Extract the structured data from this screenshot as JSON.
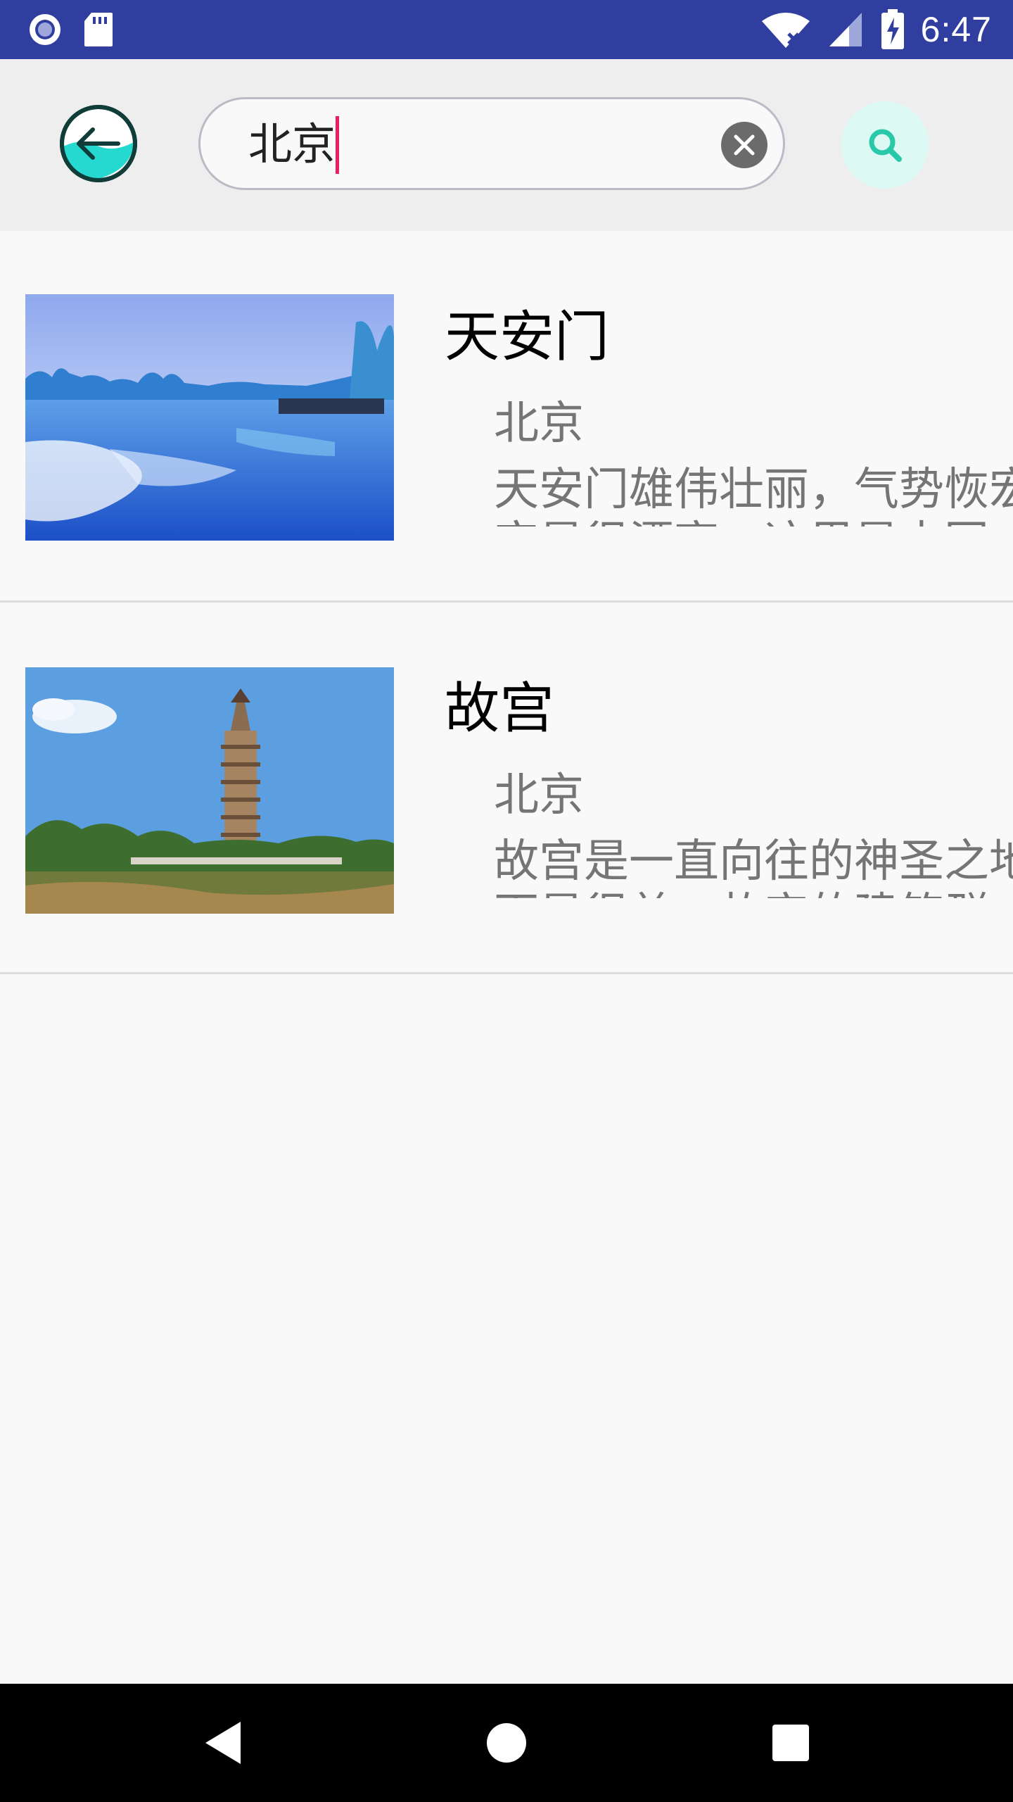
{
  "status_bar": {
    "time": "6:47",
    "icons": [
      "record-icon",
      "sd-card-icon",
      "wifi-icon",
      "signal-icon",
      "battery-charging-icon"
    ]
  },
  "header": {
    "back_icon": "back-arrow-icon",
    "search": {
      "value": "北京",
      "placeholder": ""
    },
    "clear_icon": "clear-icon",
    "search_icon": "search-icon"
  },
  "results": [
    {
      "title": "天安门",
      "city": "北京",
      "description": "天安门雄伟壮丽，气势恢宏",
      "description_line2": "宏是很漂亮，这里是中国",
      "image": "lake-mountains-image"
    },
    {
      "title": "故宫",
      "city": "北京",
      "description": "故宫是一直向往的神圣之地",
      "description_line2": "面是很美，故宫的建筑群",
      "image": "pagoda-image"
    }
  ],
  "nav_bar": {
    "icons": [
      "nav-back-icon",
      "nav-home-icon",
      "nav-recents-icon"
    ]
  },
  "colors": {
    "status_bar": "#303f9f",
    "header_bg": "#eeeeee",
    "accent_caret": "#e91e63",
    "back_icon_fill": "#26d9d0",
    "search_button_bg": "#dcfaf3"
  }
}
